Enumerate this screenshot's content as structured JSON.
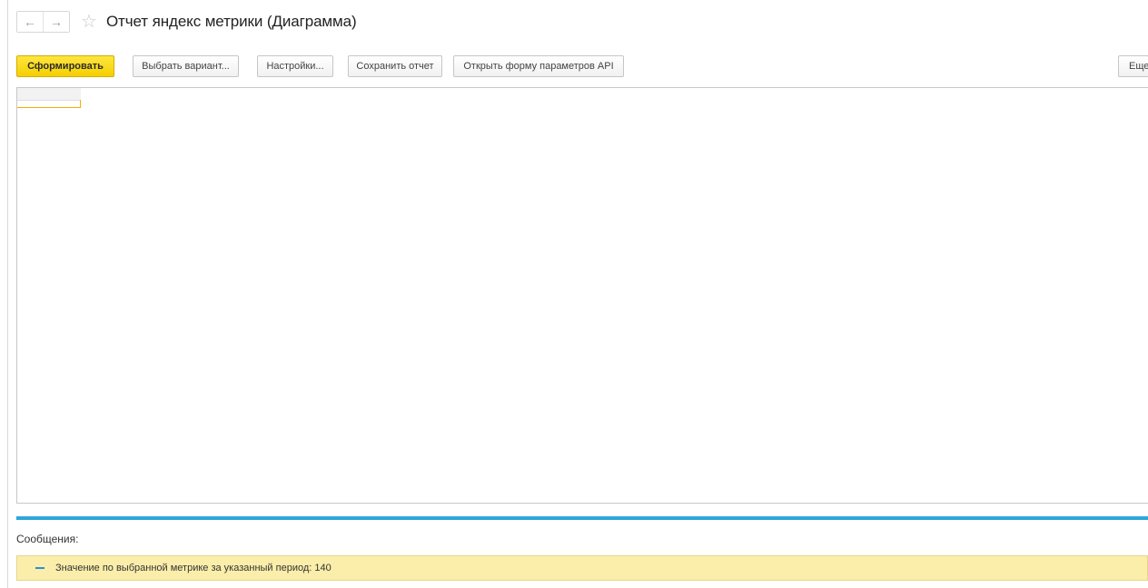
{
  "window": {
    "title": "Отчет яндекс метрики (Диаграмма)",
    "back_glyph": "←",
    "forward_glyph": "→",
    "favorite_glyph": "☆"
  },
  "toolbar": {
    "generate_label": "Сформировать",
    "choose_variant_label": "Выбрать вариант...",
    "settings_label": "Настройки...",
    "save_report_label": "Сохранить отчет",
    "open_api_params_label": "Открыть форму параметров API",
    "more_label": "Еще"
  },
  "messages": {
    "label": "Сообщения:",
    "items": [
      {
        "text": "Значение по выбранной метрике за указанный период: 140"
      }
    ]
  },
  "colors": {
    "primary_button": "#f5cf00",
    "splitter": "#2ea6dc",
    "message_background": "#fbeeaa",
    "message_marker": "#2a8fd6"
  }
}
